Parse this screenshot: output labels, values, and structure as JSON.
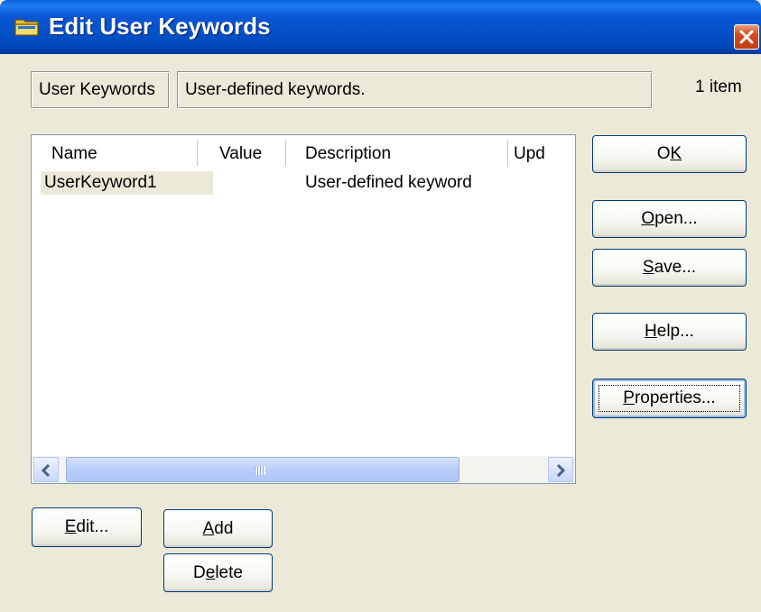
{
  "window": {
    "title": "Edit User Keywords",
    "title_icon": "folder-icon",
    "close_icon": "close-icon"
  },
  "info": {
    "category": "User Keywords",
    "description": "User-defined keywords.",
    "item_count": "1 item"
  },
  "list": {
    "columns": [
      "Name",
      "Value",
      "Description",
      "Upd"
    ],
    "rows": [
      {
        "name": "UserKeyword1",
        "value": "",
        "description": "User-defined keyword",
        "upd": ""
      }
    ],
    "scrollbar_grip": "IIII"
  },
  "buttons": {
    "ok": {
      "label": "OK",
      "mnemonic": "K"
    },
    "open": {
      "label": "Open...",
      "mnemonic": "O"
    },
    "save": {
      "label": "Save...",
      "mnemonic": "S"
    },
    "help": {
      "label": "Help...",
      "mnemonic": "H"
    },
    "properties": {
      "label": "Properties...",
      "mnemonic": "P"
    },
    "edit": {
      "label": "Edit...",
      "mnemonic": "E"
    },
    "add": {
      "label": "Add",
      "mnemonic": "A"
    },
    "delete": {
      "label": "Delete",
      "mnemonic": "e"
    }
  },
  "colors": {
    "titlebar": "#0451C8",
    "dialog_bg": "#ECE9D8",
    "selection_bg": "#ECE9D8",
    "button_border": "#003C74"
  }
}
